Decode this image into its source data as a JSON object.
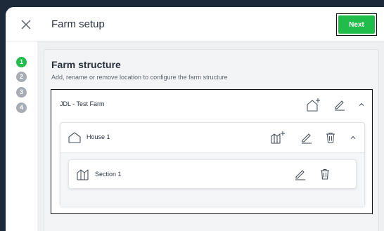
{
  "header": {
    "title": "Farm setup",
    "next_label": "Next",
    "close_icon": "close-icon"
  },
  "steps": [
    {
      "number": "1",
      "state": "active"
    },
    {
      "number": "2",
      "state": "inactive"
    },
    {
      "number": "3",
      "state": "inactive"
    },
    {
      "number": "4",
      "state": "inactive"
    }
  ],
  "structure": {
    "heading": "Farm structure",
    "description": "Add, rename or remove location to configure the farm structure",
    "farm": {
      "name": "JDL - Test Farm",
      "actions": [
        "add-house-icon",
        "edit-icon",
        "chevron-up-icon"
      ],
      "houses": [
        {
          "name": "House 1",
          "actions": [
            "add-section-icon",
            "edit-icon",
            "trash-icon",
            "chevron-up-icon"
          ],
          "sections": [
            {
              "name": "Section 1",
              "actions": [
                "edit-icon",
                "trash-icon"
              ]
            }
          ]
        }
      ]
    }
  },
  "colors": {
    "accent": "#20bd4a",
    "inactive_step": "#a6adb5",
    "frame": "#1c2a3a"
  }
}
